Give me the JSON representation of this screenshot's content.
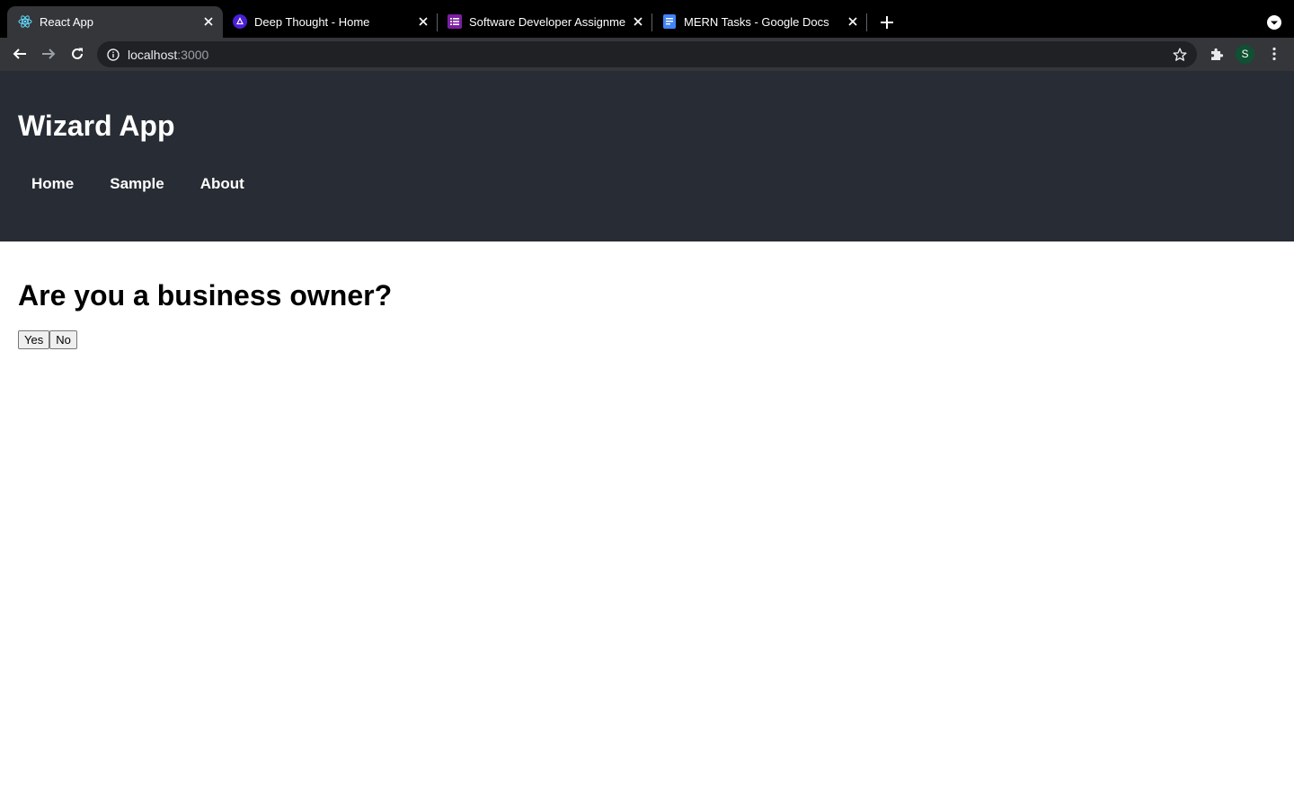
{
  "browser": {
    "tabs": [
      {
        "title": "React App",
        "favicon": "react-icon",
        "active": true
      },
      {
        "title": "Deep Thought - Home",
        "favicon": "deep-thought-icon",
        "active": false
      },
      {
        "title": "Software Developer Assignment",
        "favicon": "forms-icon",
        "active": false
      },
      {
        "title": "MERN Tasks - Google Docs",
        "favicon": "docs-icon",
        "active": false
      }
    ],
    "address_host": "localhost",
    "address_port": ":3000",
    "profile_initial": "S"
  },
  "app": {
    "title": "Wizard App",
    "nav": [
      "Home",
      "Sample",
      "About"
    ],
    "question": "Are you a business owner?",
    "answers": [
      "Yes",
      "No"
    ]
  },
  "colors": {
    "header_bg": "#282c34",
    "tabstrip_bg": "#000000",
    "toolbar_bg": "#35363a",
    "avatar_bg": "#0f5132"
  }
}
